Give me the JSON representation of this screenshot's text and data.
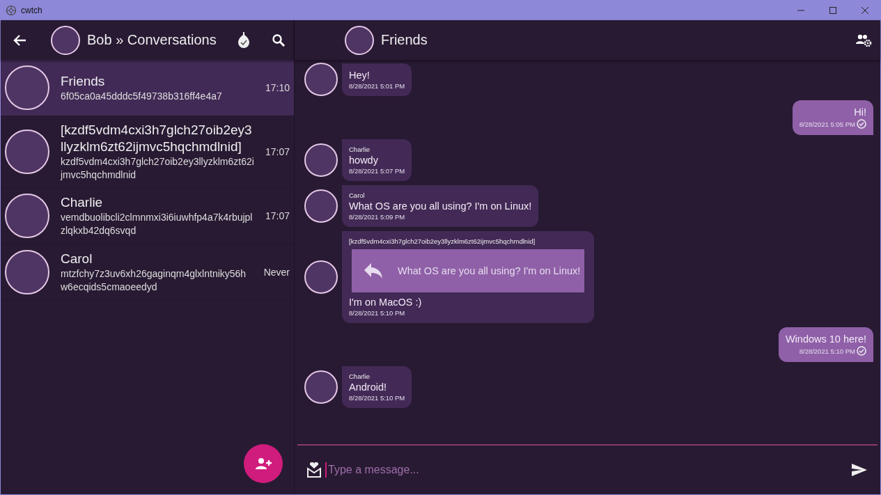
{
  "window": {
    "title": "cwtch"
  },
  "profile": {
    "title": "Bob » Conversations"
  },
  "contacts": [
    {
      "name": "Friends",
      "address": "6f05ca0a45dddc5f49738b316ff4e4a7",
      "time": "17:10",
      "selected": true
    },
    {
      "name": "[kzdf5vdm4cxi3h7glch27oib2ey3llyzklm6zt62ijmvc5hqchmdlnid]",
      "address": "kzdf5vdm4cxi3h7glch27oib2ey3llyzklm6zt62ijmvc5hqchmdlnid",
      "time": "17:07",
      "selected": false
    },
    {
      "name": "Charlie",
      "address": "vemdbuolibcli2clmnmxi3i6iuwhfp4a7k4rbujplzlqkxb42dq6svqd",
      "time": "17:07",
      "selected": false
    },
    {
      "name": "Carol",
      "address": "mtzfchy7z3uv6xh26gaginqm4glxlntniky56hw6ecqids5cmaoeedyd",
      "time": "Never",
      "selected": false
    }
  ],
  "chat": {
    "title": "Friends",
    "messages": [
      {
        "kind": "incoming",
        "text": "Hey!",
        "time": "8/28/2021 5:01 PM"
      },
      {
        "kind": "outgoing",
        "text": "Hi!",
        "time": "8/28/2021 5:05 PM",
        "acknowledged": true
      },
      {
        "kind": "incoming",
        "sender": "Charlie",
        "text": "howdy",
        "time": "8/28/2021 5:07 PM"
      },
      {
        "kind": "incoming",
        "sender": "Carol",
        "text": "What OS are you all using? I'm on Linux!",
        "time": "8/28/2021 5:09 PM"
      },
      {
        "kind": "incoming",
        "sender": "[kzdf5vdm4cxi3h7glch27oib2ey3llyzklm6zt62ijmvc5hqchmdlnid]",
        "quote": "What OS are you all using? I'm on Linux!",
        "text": "I'm on MacOS :)",
        "time": "8/28/2021 5:10 PM"
      },
      {
        "kind": "outgoing",
        "text": "Windows 10 here!",
        "time": "8/28/2021 5:10 PM",
        "acknowledged": true
      },
      {
        "kind": "incoming",
        "sender": "Charlie",
        "text": "Android!",
        "time": "8/28/2021 5:10 PM"
      }
    ],
    "composer": {
      "placeholder": "Type a message..."
    }
  }
}
